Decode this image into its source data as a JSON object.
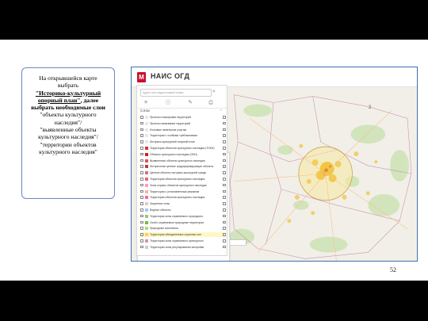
{
  "instruction": {
    "line1": "На открывшейся карте",
    "line2": "выбрать",
    "line3_link": "\"Историко-культурный",
    "line4_link": "опорный план\"",
    "line4_rest": ", далее",
    "line5": "выбрать необходимые слои",
    "line6": "\"объекты культурного",
    "line7": "наследия\"/",
    "line8": "\"выявленные объекты",
    "line9": "культурного наследия\"/",
    "line10": "\"территории объектов",
    "line11": "культурного наследия\""
  },
  "app": {
    "logo_letter": "М",
    "title": "НАИС ОГД",
    "search_placeholder": "Адрес или кадастровый номер",
    "layers_heading": "Слои",
    "map_label": "2",
    "layers": [
      {
        "label": "Проекты планировки территорий",
        "color": "#e8e8e8"
      },
      {
        "label": "Проекты межевания территорий",
        "color": "#e8e8e8"
      },
      {
        "label": "Итоговые земельные участки",
        "color": "#e8e8e8"
      },
      {
        "label": "Территории с особыми требованиями",
        "color": "#e8e8e8"
      },
      {
        "label": "Историко-культурный опорный план",
        "color": "#e8e8e8"
      },
      {
        "label": "Территории объектов культурного наследия (ТОКН)",
        "color": "#d33"
      },
      {
        "label": "Объекты культурного наследия (ОКН)",
        "color": "#c22"
      },
      {
        "label": "Выявленные объекты культурного наследия",
        "color": "#d55"
      },
      {
        "label": "Исторически ценные градоформирующие объекты",
        "color": "#a44"
      },
      {
        "label": "Ценные объекты историко-культурной среды",
        "color": "#c77"
      },
      {
        "label": "Территории объектов культурного наследия",
        "color": "#e66"
      },
      {
        "label": "Зоны охраны объектов культурного наследия",
        "color": "#f9c"
      },
      {
        "label": "Территории с установленным режимом",
        "color": "#eb9"
      },
      {
        "label": "Территории объектов культурного наследия",
        "color": "#f6a"
      },
      {
        "label": "Защитные зоны",
        "color": "#dcb"
      },
      {
        "label": "Водные объекты",
        "color": "#9cf"
      },
      {
        "label": "Территории зоны охраняемого природного",
        "color": "#9c6"
      },
      {
        "label": "Особо охраняемые природные территории",
        "color": "#7b4"
      },
      {
        "label": "Природные комплексы",
        "color": "#ad7"
      },
      {
        "label": "Территории объединенных охранных зон",
        "color": "#fc6"
      },
      {
        "label": "Территории зоны охраняемого культурного",
        "color": "#c9a"
      },
      {
        "label": "Территории зоны регулирования застройки",
        "color": "#ccc"
      }
    ],
    "tooltip": "Территории объединенных охранных зон"
  },
  "page_number": "52"
}
